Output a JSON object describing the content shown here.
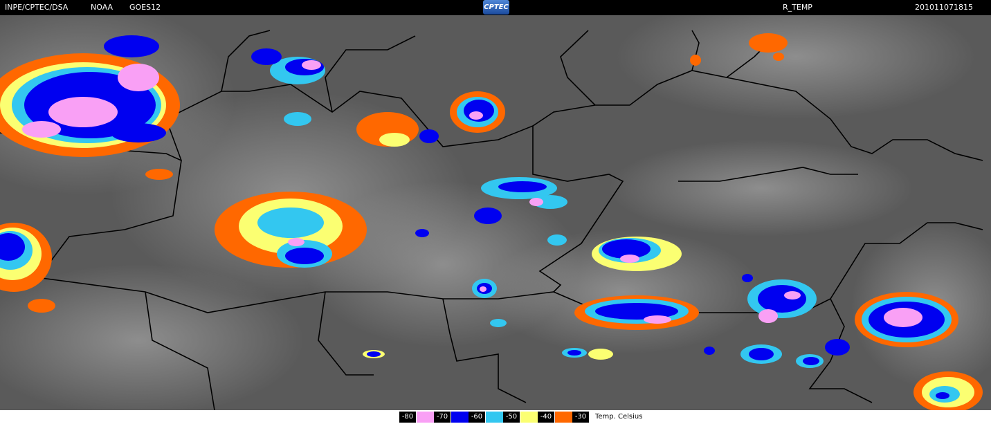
{
  "header": {
    "source": "INPE/CPTEC/DSA",
    "agency": "NOAA",
    "satellite": "GOES12",
    "logo_text": "CPTEC",
    "product": "R_TEMP",
    "timestamp": "201011071815"
  },
  "colors": {
    "minus80": "#f9a0f5",
    "minus70": "#0000f0",
    "minus60": "#33c7f0",
    "minus50": "#fbff72",
    "minus40": "#ff6800",
    "background_gray": "#5c5c5c",
    "borders": "#000000"
  },
  "legend": {
    "unit_label": "Temp. Celsius",
    "levels": [
      {
        "label": "-80",
        "color": "#f9a0f5"
      },
      {
        "label": "-70",
        "color": "#0000f0"
      },
      {
        "label": "-60",
        "color": "#33c7f0"
      },
      {
        "label": "-50",
        "color": "#fbff72"
      },
      {
        "label": "-40",
        "color": "#ff6800"
      },
      {
        "label": "-30",
        "color": ""
      }
    ]
  }
}
